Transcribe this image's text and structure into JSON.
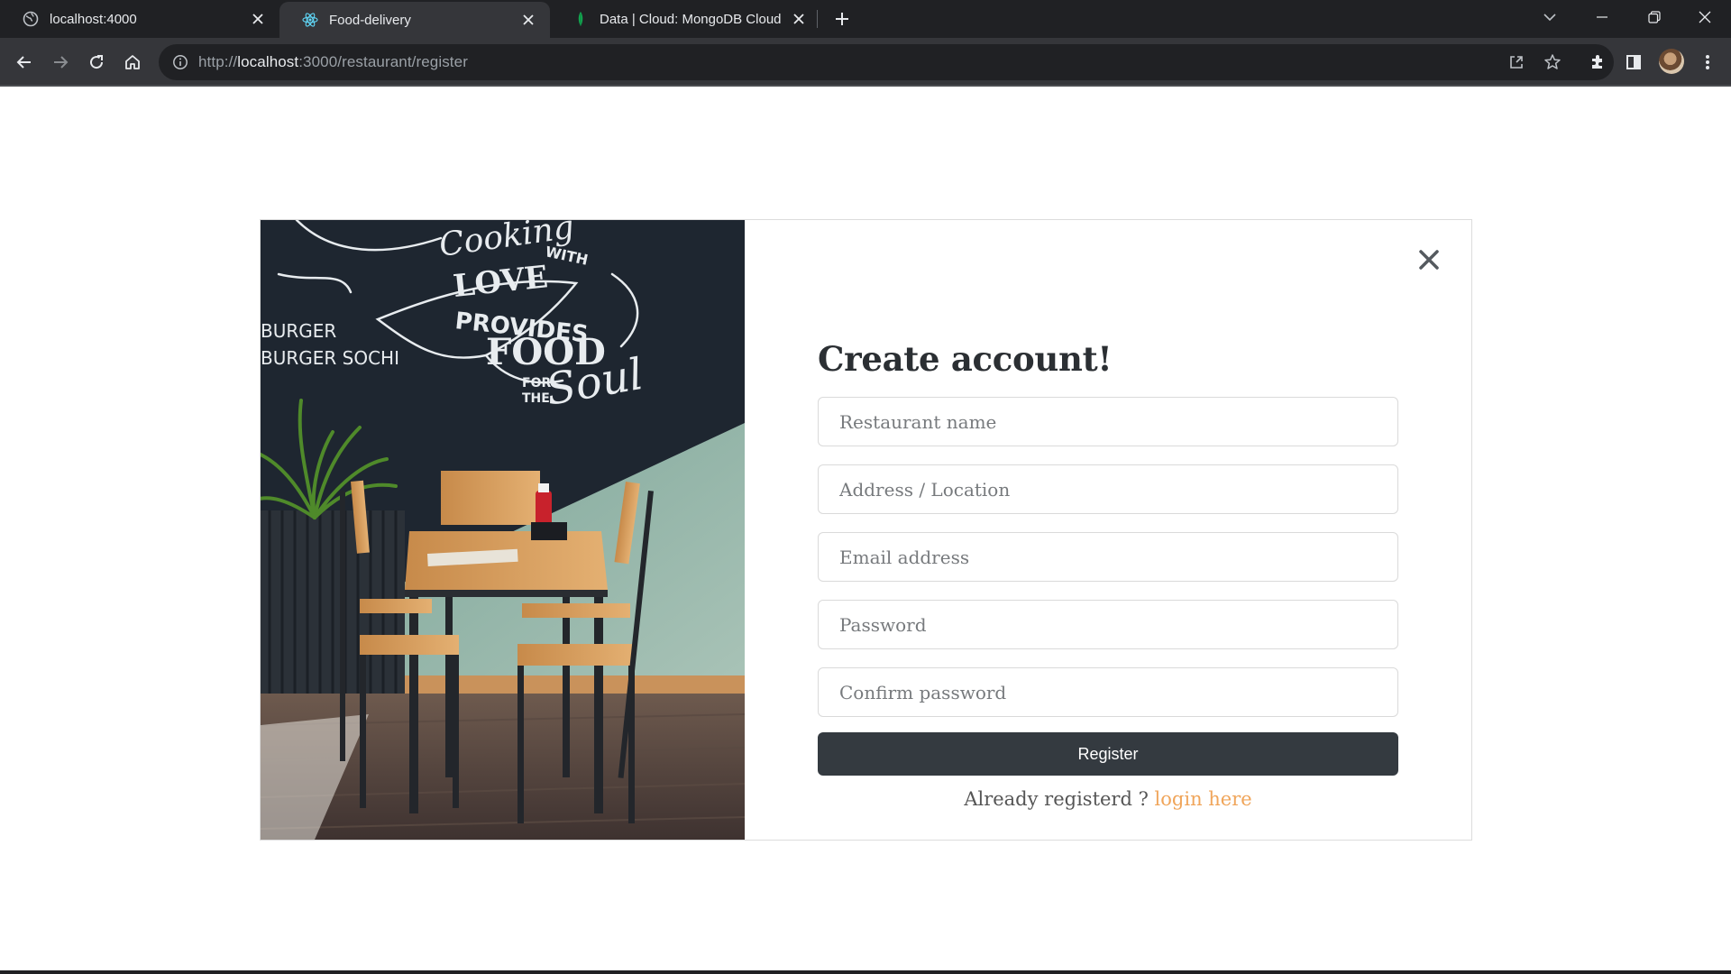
{
  "browser": {
    "tabs": [
      {
        "title": "localhost:4000",
        "icon": "globe-icon",
        "active": false
      },
      {
        "title": "Food-delivery",
        "icon": "react-icon",
        "active": true
      },
      {
        "title": "Data | Cloud: MongoDB Cloud",
        "icon": "mongodb-leaf-icon",
        "active": false
      }
    ],
    "url": {
      "scheme": "http://",
      "host": "localhost",
      "rest": ":3000/restaurant/register"
    }
  },
  "form": {
    "title": "Create account!",
    "fields": {
      "restaurant_name": {
        "placeholder": "Restaurant name",
        "value": ""
      },
      "address": {
        "placeholder": "Address / Location",
        "value": ""
      },
      "email": {
        "placeholder": "Email address",
        "value": ""
      },
      "password": {
        "placeholder": "Password",
        "value": ""
      },
      "confirm_password": {
        "placeholder": "Confirm password",
        "value": ""
      }
    },
    "submit_label": "Register",
    "login_prompt": "Already registerd ?",
    "login_link": "login  here"
  },
  "photo": {
    "lettering": "Cooking with LOVE provides FOOD for the Soul",
    "side_lettering": "Burger Burger Sochi"
  },
  "colors": {
    "tab_strip": "#202124",
    "toolbar": "#35363a",
    "button_bg": "#343a40",
    "link": "#f0a55a",
    "card_border": "#dcdcdc"
  }
}
